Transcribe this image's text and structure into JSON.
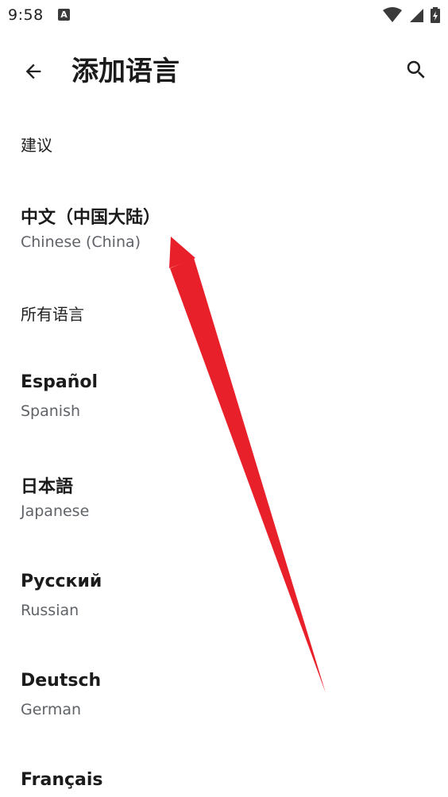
{
  "status_bar": {
    "time": "9:58",
    "notification_icon_letter": "A",
    "icons": [
      "wifi-icon",
      "signal-icon",
      "battery-icon"
    ]
  },
  "app_bar": {
    "back_icon": "arrow-back-icon",
    "title": "添加语言",
    "search_icon": "search-icon"
  },
  "sections": {
    "suggested_header": "建议",
    "all_header": "所有语言"
  },
  "suggested": [
    {
      "primary": "中文（中国大陆）",
      "secondary": "Chinese (China)"
    }
  ],
  "languages": [
    {
      "primary": "Español",
      "secondary": "Spanish"
    },
    {
      "primary": "日本語",
      "secondary": "Japanese"
    },
    {
      "primary": "Русский",
      "secondary": "Russian"
    },
    {
      "primary": "Deutsch",
      "secondary": "German"
    },
    {
      "primary": "Français",
      "secondary": ""
    }
  ],
  "colors": {
    "annotation_arrow": "#e8202a",
    "secondary_text": "#5f6368"
  }
}
